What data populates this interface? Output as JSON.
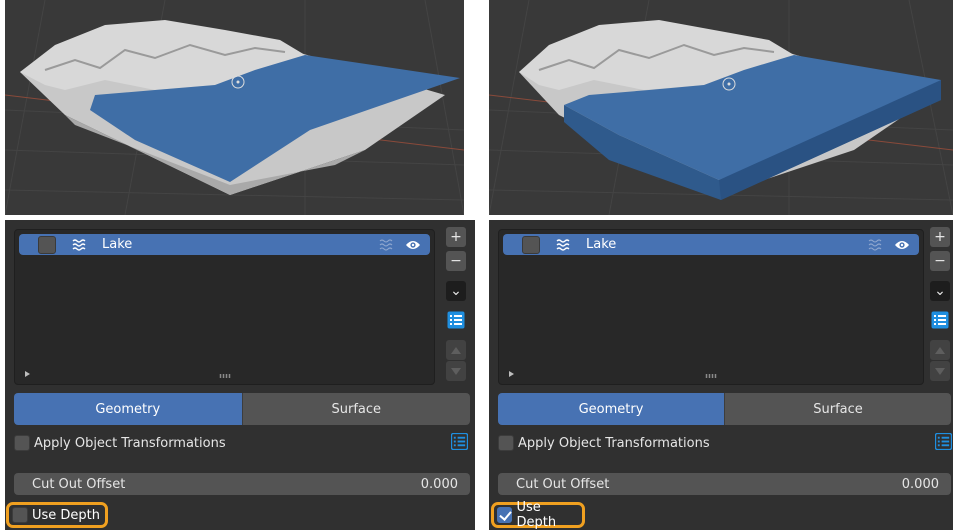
{
  "panels": [
    {
      "list": {
        "item_label": "Lake"
      },
      "tabs": [
        {
          "label": "Geometry",
          "active": true
        },
        {
          "label": "Surface",
          "active": false
        }
      ],
      "apply": {
        "label": "Apply Object Transformations",
        "checked": false
      },
      "cut_out": {
        "label": "Cut Out Offset",
        "value": "0.000"
      },
      "use_depth": {
        "label": "Use Depth",
        "checked": false
      }
    },
    {
      "list": {
        "item_label": "Lake"
      },
      "tabs": [
        {
          "label": "Geometry",
          "active": true
        },
        {
          "label": "Surface",
          "active": false
        }
      ],
      "apply": {
        "label": "Apply Object Transformations",
        "checked": false
      },
      "cut_out": {
        "label": "Cut Out Offset",
        "value": "0.000"
      },
      "use_depth": {
        "label": "Use Depth",
        "checked": true
      }
    }
  ],
  "side_buttons": [
    "+",
    "−",
    "⌄"
  ],
  "colors": {
    "accent": "#4772b3",
    "highlight": "#f0a020",
    "water": "#3f6ea6"
  }
}
